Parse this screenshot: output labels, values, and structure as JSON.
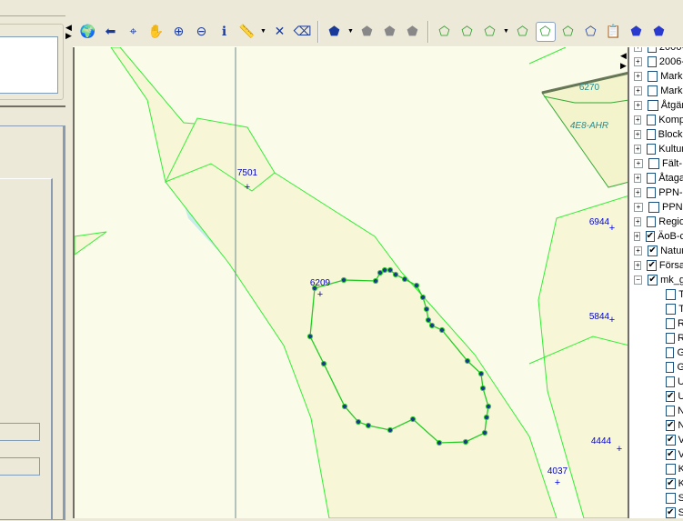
{
  "toolbar": {
    "tools": [
      {
        "name": "full-extent-icon",
        "glyph": "🌍"
      },
      {
        "name": "back-icon",
        "glyph": "⬅"
      },
      {
        "name": "zoom-to-layer-icon",
        "glyph": "⌖"
      },
      {
        "name": "pan-hand-icon",
        "glyph": "✋"
      },
      {
        "name": "zoom-in-icon",
        "glyph": "⊕"
      },
      {
        "name": "zoom-out-icon",
        "glyph": "⊖"
      },
      {
        "name": "identify-icon",
        "glyph": "ℹ"
      },
      {
        "name": "measure-icon",
        "glyph": "📏"
      },
      {
        "name": "clear-measure-icon",
        "glyph": "✕"
      },
      {
        "name": "eraser-icon",
        "glyph": "⌫"
      },
      {
        "name": "select-feature-icon",
        "glyph": "⬟"
      },
      {
        "name": "edit-disabled-icon",
        "glyph": "⬟"
      },
      {
        "name": "reshape-disabled-icon",
        "glyph": "⬟"
      },
      {
        "name": "delete-disabled-icon",
        "glyph": "⬟"
      },
      {
        "name": "select-polygon-icon",
        "glyph": "⬠"
      },
      {
        "name": "zoom-polygon-icon",
        "glyph": "⬠"
      },
      {
        "name": "select-polygon-2-icon",
        "glyph": "⬠"
      },
      {
        "name": "delete-polygon-icon",
        "glyph": "⬠"
      },
      {
        "name": "edit-vertices-icon",
        "glyph": "⬠"
      },
      {
        "name": "reshape-polygon-icon",
        "glyph": "⬠"
      },
      {
        "name": "copy-polygon-icon",
        "glyph": "⬠"
      },
      {
        "name": "paste-polygon-icon",
        "glyph": "📋"
      },
      {
        "name": "select-blue-icon",
        "glyph": "⬟"
      },
      {
        "name": "deselect-blue-icon",
        "glyph": "⬟"
      }
    ]
  },
  "map": {
    "labels": [
      {
        "text": "7501",
        "cross": true
      },
      {
        "text": "6209",
        "cross": true
      },
      {
        "text": "6944",
        "cross": true
      },
      {
        "text": "5844",
        "cross": true
      },
      {
        "text": "4444",
        "cross": true
      },
      {
        "text": "4037",
        "cross": true
      },
      {
        "text": "6270",
        "cross": false
      },
      {
        "text": "4E8-AHR",
        "cross": false
      }
    ],
    "colors": {
      "parcel_line": "#33ee33",
      "parcel_fill": "#f7f7d8",
      "water": "#c8ecea",
      "vertex": "#1a3a8a",
      "label": "#0000cc"
    }
  },
  "tree": {
    "items": [
      {
        "label": "2006-",
        "checked": false,
        "child": false
      },
      {
        "label": "2006-",
        "checked": false,
        "child": false
      },
      {
        "label": "Markl",
        "checked": false,
        "child": false
      },
      {
        "label": "Markl",
        "checked": false,
        "child": false
      },
      {
        "label": "Åtgär",
        "checked": false,
        "child": false
      },
      {
        "label": "Komp",
        "checked": false,
        "child": false
      },
      {
        "label": "Blockl",
        "checked": false,
        "child": false
      },
      {
        "label": "Kultur",
        "checked": false,
        "child": false
      },
      {
        "label": "Fält-",
        "checked": false,
        "child": false
      },
      {
        "label": "Åtaga",
        "checked": false,
        "child": false
      },
      {
        "label": "PPN-l",
        "checked": false,
        "child": false
      },
      {
        "label": "PPN",
        "checked": false,
        "child": false
      },
      {
        "label": "Regio",
        "checked": false,
        "child": false
      },
      {
        "label": "ÄoB-c",
        "checked": true,
        "child": false
      },
      {
        "label": "Natur",
        "checked": true,
        "child": false
      },
      {
        "label": "Försa",
        "checked": true,
        "child": false
      },
      {
        "label": "mk_g",
        "checked": true,
        "child": false,
        "expanded": true
      },
      {
        "label": "T",
        "checked": false,
        "child": true
      },
      {
        "label": "T",
        "checked": false,
        "child": true
      },
      {
        "label": "R",
        "checked": false,
        "child": true
      },
      {
        "label": "R",
        "checked": false,
        "child": true
      },
      {
        "label": "G",
        "checked": false,
        "child": true
      },
      {
        "label": "G",
        "checked": false,
        "child": true
      },
      {
        "label": "U",
        "checked": false,
        "child": true
      },
      {
        "label": "U",
        "checked": true,
        "child": true
      },
      {
        "label": "N",
        "checked": false,
        "child": true
      },
      {
        "label": "N",
        "checked": true,
        "child": true
      },
      {
        "label": "V",
        "checked": true,
        "child": true
      },
      {
        "label": "V",
        "checked": true,
        "child": true
      },
      {
        "label": "K",
        "checked": false,
        "child": true
      },
      {
        "label": "K",
        "checked": true,
        "child": true
      },
      {
        "label": "S",
        "checked": false,
        "child": true
      },
      {
        "label": "S",
        "checked": true,
        "child": true
      }
    ]
  }
}
